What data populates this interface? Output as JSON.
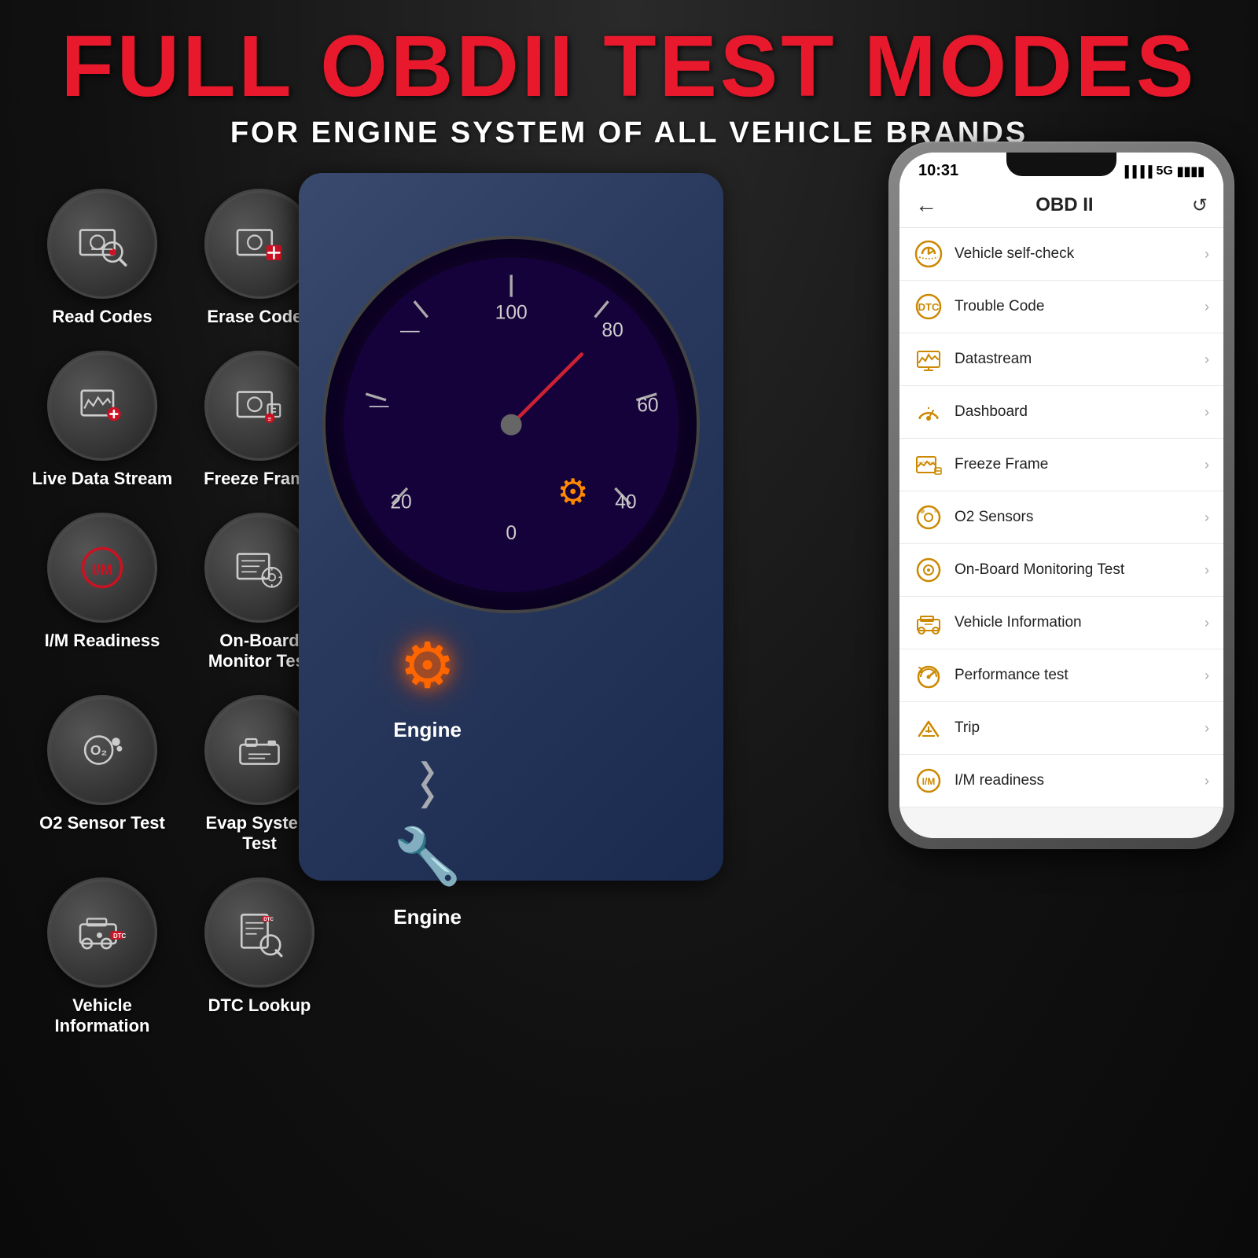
{
  "header": {
    "title": "FULL OBDII TEST MODES",
    "subtitle": "FOR ENGINE SYSTEM OF ALL VEHICLE BRANDS"
  },
  "icons": [
    {
      "id": "read-codes",
      "label": "Read Codes",
      "type": "read"
    },
    {
      "id": "erase-codes",
      "label": "Erase Codes",
      "type": "erase"
    },
    {
      "id": "live-data-stream",
      "label": "Live Data Stream",
      "type": "live"
    },
    {
      "id": "freeze-frame",
      "label": "Freeze Frame",
      "type": "freeze"
    },
    {
      "id": "im-readiness",
      "label": "I/M Readiness",
      "type": "im"
    },
    {
      "id": "on-board-monitor",
      "label": "On-Board Monitor Test",
      "type": "onboard"
    },
    {
      "id": "o2-sensor",
      "label": "O2 Sensor Test",
      "type": "o2"
    },
    {
      "id": "evap-system",
      "label": "Evap System Test",
      "type": "evap"
    },
    {
      "id": "vehicle-info",
      "label": "Vehicle Information",
      "type": "vehicle"
    },
    {
      "id": "dtc-lookup",
      "label": "DTC Lookup",
      "type": "dtc"
    }
  ],
  "phone": {
    "status_time": "10:31",
    "status_signal": "5G",
    "app_title": "OBD II",
    "back_label": "←",
    "refresh_label": "↺",
    "menu_items": [
      {
        "id": "vehicle-self-check",
        "label": "Vehicle self-check",
        "icon_type": "self-check"
      },
      {
        "id": "trouble-code",
        "label": "Trouble Code",
        "icon_type": "trouble"
      },
      {
        "id": "datastream",
        "label": "Datastream",
        "icon_type": "data"
      },
      {
        "id": "dashboard",
        "label": "Dashboard",
        "icon_type": "dashboard"
      },
      {
        "id": "freeze-frame",
        "label": "Freeze Frame",
        "icon_type": "freeze"
      },
      {
        "id": "o2-sensors",
        "label": "O2 Sensors",
        "icon_type": "o2"
      },
      {
        "id": "on-board-monitoring",
        "label": "On-Board Monitoring Test",
        "icon_type": "onboard"
      },
      {
        "id": "vehicle-information",
        "label": "Vehicle Information",
        "icon_type": "vehicle"
      },
      {
        "id": "performance-test",
        "label": "Performance test",
        "icon_type": "performance"
      },
      {
        "id": "trip",
        "label": "Trip",
        "icon_type": "trip"
      },
      {
        "id": "im-readiness",
        "label": "I/M readiness",
        "icon_type": "im"
      }
    ]
  },
  "engine": {
    "label1": "Engine",
    "label2": "Engine"
  }
}
